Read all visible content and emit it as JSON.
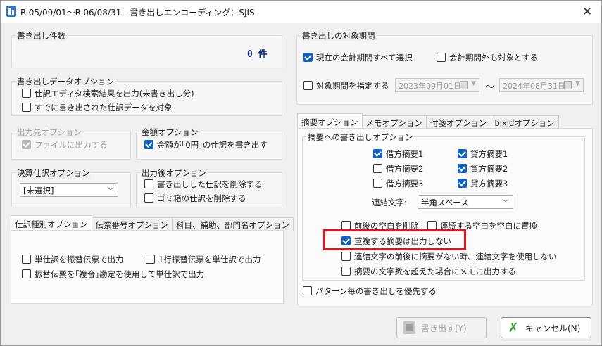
{
  "window": {
    "title": "R.05/09/01～R.06/08/31 - 書き出しエンコーディング：SJIS"
  },
  "export_count": {
    "label": "書き出し件数",
    "value": "0 件"
  },
  "data_options": {
    "label": "書き出しデータオプション",
    "items": [
      {
        "label": "仕訳エディタ検索結果を出力(未書き出し分)",
        "checked": false
      },
      {
        "label": "すでに書き出された仕訳データを対象",
        "checked": false
      }
    ]
  },
  "output_dest": {
    "label": "出力先オプション",
    "item": {
      "label": "ファイルに出力する",
      "checked": true
    }
  },
  "amount_options": {
    "label": "金額オプション",
    "item": {
      "label": "金額が｢0円｣の仕訳を書き出す",
      "checked": true
    }
  },
  "settlement": {
    "label": "決算仕訳オプション",
    "selected": "[未選択]"
  },
  "after_output": {
    "label": "出力後オプション",
    "items": [
      {
        "label": "書き出しした仕訳を削除する",
        "checked": false
      },
      {
        "label": "ゴミ箱の仕訳を削除する",
        "checked": false
      }
    ]
  },
  "left_tabs": {
    "tabs": [
      "仕訳種別オプション",
      "伝票番号オプション",
      "科目、補助、部門名オプション"
    ],
    "items": [
      {
        "label": "単仕訳を振替伝票で出力",
        "checked": false
      },
      {
        "label": "1行振替伝票を単仕訳で出力",
        "checked": false
      },
      {
        "label": "振替伝票を｢複合｣勘定を使用して単仕訳で出力",
        "checked": false
      }
    ]
  },
  "period": {
    "label": "書き出しの対象期間",
    "select_all": {
      "label": "現在の会計期間すべて選択",
      "checked": true
    },
    "include_outside": {
      "label": "会計期間外も対象とする",
      "checked": false
    },
    "specify": {
      "label": "対象期間を指定する",
      "checked": false
    },
    "start_date": "2023年09月01日",
    "tilde": "～",
    "end_date": "2024年08月31日"
  },
  "right_tabs": {
    "tabs": [
      "摘要オプション",
      "メモオプション",
      "付箋オプション",
      "bixidオプション"
    ],
    "group_label": "摘要への書き出しオプション",
    "debit": [
      {
        "label": "借方摘要1",
        "checked": true
      },
      {
        "label": "借方摘要2",
        "checked": false
      },
      {
        "label": "借方摘要3",
        "checked": false
      }
    ],
    "credit": [
      {
        "label": "貸方摘要1",
        "checked": true
      },
      {
        "label": "貸方摘要2",
        "checked": true
      },
      {
        "label": "貸方摘要3",
        "checked": true
      }
    ],
    "join_label": "連結文字:",
    "join_value": "半角スペース",
    "trim": {
      "label": "前後の空白を削除",
      "checked": false
    },
    "replace": {
      "label": "連続する空白を空白に置換",
      "checked": false
    },
    "no_dup": {
      "label": "重複する摘要は出力しない",
      "checked": true
    },
    "no_join": {
      "label": "連結文字の前後に摘要がない時、連結文字を使用しない",
      "checked": false
    },
    "overflow_memo": {
      "label": "摘要の文字数を超えた場合にメモに出力する",
      "checked": false
    },
    "pattern_priority": {
      "label": "パターン毎の書き出しを優先する",
      "checked": false
    }
  },
  "buttons": {
    "export": "書き出す(Y)",
    "cancel": "キャンセル(N)"
  },
  "colors": {
    "accent": "#0f62c4",
    "highlight": "#e3141b",
    "cancel_icon": "#2e9c2e"
  },
  "icons": {
    "app": "app-icon",
    "close": "close-icon",
    "export": "export-icon",
    "cancel": "cancel-x-icon"
  }
}
